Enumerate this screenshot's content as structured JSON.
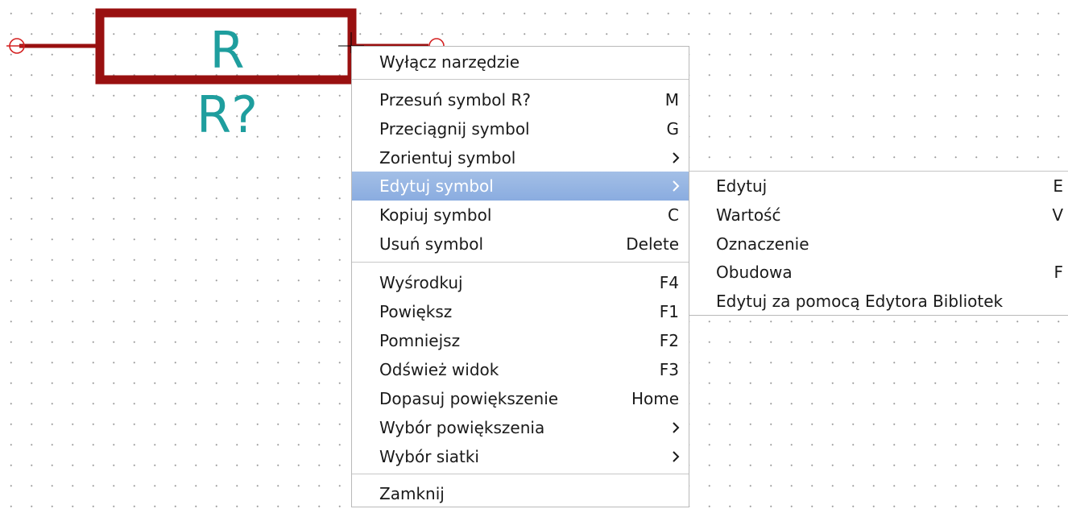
{
  "schematic": {
    "reference": "R",
    "value_text": "R?"
  },
  "colors": {
    "body_outline": "#991010",
    "wire": "#991010",
    "pin_marker": "#d42020",
    "text_teal": "#1e9e9e",
    "highlight": "#8aace0",
    "grid_dot": "#9c9c9c"
  },
  "context_menu": {
    "items": [
      {
        "label": "Wyłącz narzędzie",
        "shortcut": ""
      },
      {
        "label": "Przesuń symbol R?",
        "shortcut": "M"
      },
      {
        "label": "Przeciągnij symbol",
        "shortcut": "G"
      },
      {
        "label": "Zorientuj symbol",
        "shortcut": "",
        "submenu_icon": "chevron-right-icon"
      },
      {
        "label": "Edytuj symbol",
        "shortcut": "",
        "submenu_icon": "chevron-right-icon",
        "highlighted": true
      },
      {
        "label": "Kopiuj symbol",
        "shortcut": "C"
      },
      {
        "label": "Usuń symbol",
        "shortcut": "Delete"
      },
      {
        "label": "Wyśrodkuj",
        "shortcut": "F4"
      },
      {
        "label": "Powiększ",
        "shortcut": "F1"
      },
      {
        "label": "Pomniejsz",
        "shortcut": "F2"
      },
      {
        "label": "Odśwież widok",
        "shortcut": "F3"
      },
      {
        "label": "Dopasuj powiększenie",
        "shortcut": "Home"
      },
      {
        "label": "Wybór powiększenia",
        "shortcut": "",
        "submenu_icon": "chevron-right-icon"
      },
      {
        "label": "Wybór siatki",
        "shortcut": "",
        "submenu_icon": "chevron-right-icon"
      },
      {
        "label": "Zamknij",
        "shortcut": ""
      }
    ]
  },
  "edit_submenu": {
    "items": [
      {
        "label": "Edytuj",
        "shortcut": "E"
      },
      {
        "label": "Wartość",
        "shortcut": "V"
      },
      {
        "label": "Oznaczenie",
        "shortcut": ""
      },
      {
        "label": "Obudowa",
        "shortcut": "F"
      },
      {
        "label": "Edytuj za pomocą Edytora Bibliotek",
        "shortcut": ""
      }
    ]
  }
}
